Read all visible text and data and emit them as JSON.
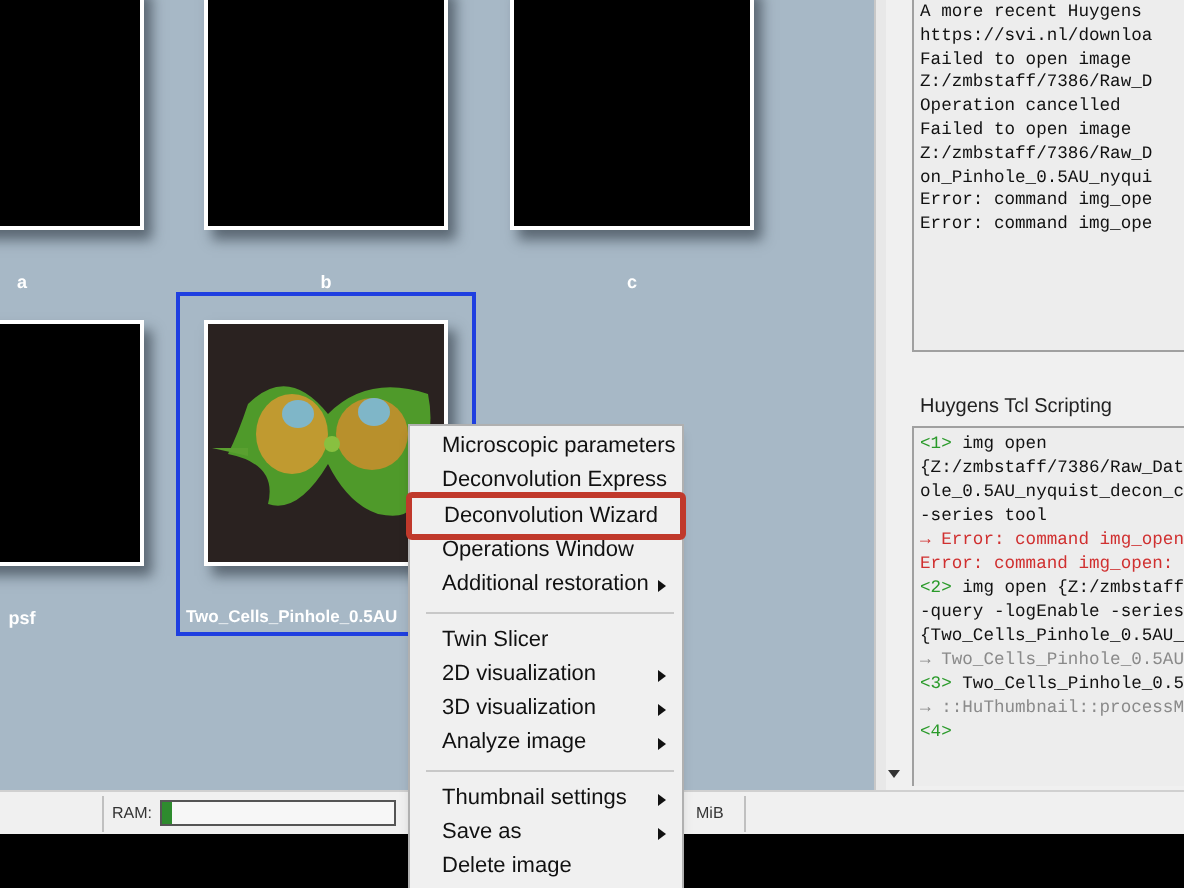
{
  "thumbnails": [
    {
      "label": "a",
      "kind": "blank",
      "selected": false
    },
    {
      "label": "b",
      "kind": "blank",
      "selected": false
    },
    {
      "label": "c",
      "kind": "blank",
      "selected": false
    },
    {
      "label": "psf",
      "kind": "blank",
      "selected": false
    },
    {
      "label": "Two_Cells_Pinhole_0.5AU",
      "kind": "picture",
      "selected": true
    }
  ],
  "log": [
    "A more recent Huygens",
    "https://svi.nl/downloa",
    "Failed to open image",
    "Z:/zmbstaff/7386/Raw_D",
    "Operation cancelled",
    "Failed to open image",
    "Z:/zmbstaff/7386/Raw_D",
    "on_Pinhole_0.5AU_nyqui",
    "Error: command img_ope",
    "Error: command img_ope"
  ],
  "tcl": {
    "title": "Huygens Tcl Scripting",
    "lines": [
      [
        {
          "kind": "prompt",
          "text": "<1>"
        },
        {
          "kind": "command",
          "text": " img open"
        }
      ],
      [
        {
          "kind": "command",
          "text": "{Z:/zmbstaff/7386/Raw_Dat"
        }
      ],
      [
        {
          "kind": "command",
          "text": "ole_0.5AU_nyquist_decon_c"
        }
      ],
      [
        {
          "kind": "command",
          "text": "-series tool"
        }
      ],
      [
        {
          "kind": "error",
          "text": "→ Error: command img_open"
        }
      ],
      [
        {
          "kind": "error",
          "text": "Error: command img_open:"
        }
      ],
      [
        {
          "kind": "prompt",
          "text": "<2>"
        },
        {
          "kind": "command",
          "text": " img open {Z:/zmbstaff"
        }
      ],
      [
        {
          "kind": "command",
          "text": "-query -logEnable -series"
        }
      ],
      [
        {
          "kind": "command",
          "text": "{Two_Cells_Pinhole_0.5AU_"
        }
      ],
      [
        {
          "kind": "result",
          "text": "→ Two_Cells_Pinhole_0.5AU"
        }
      ],
      [
        {
          "kind": "prompt",
          "text": "<3>"
        },
        {
          "kind": "command",
          "text": " Two_Cells_Pinhole_0.5"
        }
      ],
      [
        {
          "kind": "result",
          "text": "→ ::HuThumbnail::processM"
        }
      ],
      [
        {
          "kind": "prompt",
          "text": "<4>"
        }
      ]
    ]
  },
  "status_bar": {
    "ram_label": "RAM:",
    "ram": {
      "level": 0.04
    },
    "reading": "MiB"
  },
  "context_menu": [
    {
      "kind": "item",
      "label": "Microscopic parameters",
      "submenu": false,
      "highlighted": false
    },
    {
      "kind": "item",
      "label": "Deconvolution Express",
      "submenu": false,
      "highlighted": false
    },
    {
      "kind": "item",
      "label": "Deconvolution Wizard",
      "submenu": false,
      "highlighted": true
    },
    {
      "kind": "item",
      "label": "Operations Window",
      "submenu": false,
      "highlighted": false
    },
    {
      "kind": "item",
      "label": "Additional restoration",
      "submenu": true,
      "highlighted": false
    },
    {
      "kind": "separator"
    },
    {
      "kind": "item",
      "label": "Twin Slicer",
      "submenu": false,
      "highlighted": false
    },
    {
      "kind": "item",
      "label": "2D visualization",
      "submenu": true,
      "highlighted": false
    },
    {
      "kind": "item",
      "label": "3D visualization",
      "submenu": true,
      "highlighted": false
    },
    {
      "kind": "item",
      "label": "Analyze image",
      "submenu": true,
      "highlighted": false
    },
    {
      "kind": "separator"
    },
    {
      "kind": "item",
      "label": "Thumbnail settings",
      "submenu": true,
      "highlighted": false
    },
    {
      "kind": "item",
      "label": "Save as",
      "submenu": true,
      "highlighted": false
    },
    {
      "kind": "item",
      "label": "Delete image",
      "submenu": false,
      "highlighted": false
    }
  ]
}
